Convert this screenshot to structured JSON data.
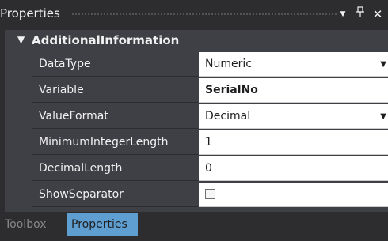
{
  "panel": {
    "title": "Properties",
    "buttons": {
      "dropdown_glyph": "▾",
      "pin_glyph": "ᵖ",
      "close_glyph": "✕"
    }
  },
  "category": {
    "arrow": "▼",
    "label": "AdditionalInformation"
  },
  "properties": [
    {
      "name": "DataType",
      "value": "Numeric"
    },
    {
      "name": "Variable",
      "value": "SerialNo"
    },
    {
      "name": "ValueFormat",
      "value": "Decimal"
    },
    {
      "name": "MinimumIntegerLength",
      "value": "1"
    },
    {
      "name": "DecimalLength",
      "value": "0"
    },
    {
      "name": "ShowSeparator",
      "value": "",
      "checked": false
    }
  ],
  "dropdown_arrow": "▼",
  "tabs": [
    {
      "label": "Toolbox",
      "active": false
    },
    {
      "label": "Properties",
      "active": true
    }
  ],
  "colors": {
    "background": "#2d2d30",
    "row_background": "#3f3f46",
    "active_tab": "#5f9ed1"
  }
}
